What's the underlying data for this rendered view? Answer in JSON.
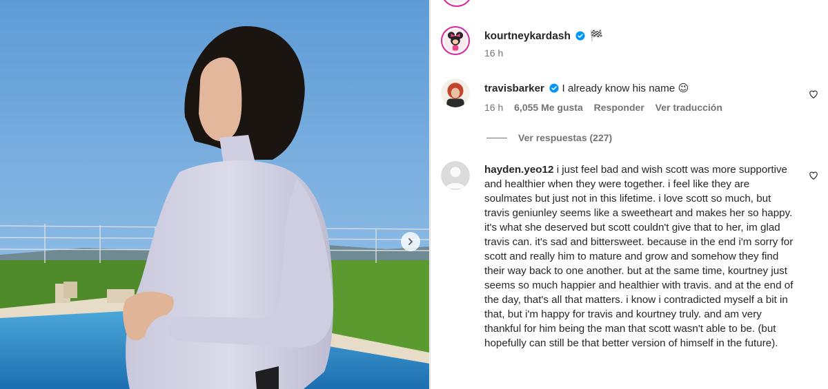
{
  "post": {
    "author": "kourtneykardash",
    "author_time": "16 h",
    "flag_emoji": "🏁"
  },
  "comments": [
    {
      "user": "travisbarker",
      "verified": true,
      "text": "I already know his name 😉",
      "time": "16 h",
      "likes": "6,055 Me gusta",
      "reply": "Responder",
      "translate": "Ver traducción"
    },
    {
      "user": "hayden.yeo12",
      "verified": false,
      "text": "i just feel bad and wish scott was more supportive and healthier when they were together. i feel like they are soulmates but just not in this lifetime. i love scott so much, but travis geniunley seems like a sweetheart and makes her so happy. it's what she deserved but scott couldn't give that to her, im glad travis can. it's sad and bittersweet. because in the end i'm sorry for scott and really him to mature and grow and somehow they find their way back to one another. but at the same time, kourtney just seems so much happier and healthier with travis. and at the end of the day, that's all that matters. i know i contradicted myself a bit in that, but i'm happy for travis and kourtney truly. and am very thankful for him being the man that scott wasn't able to be. (but hopefully can still be that better version of himself in the future)."
    }
  ],
  "view_replies": "Ver respuestas (227)",
  "colors": {
    "text": "#262626",
    "muted": "#737373",
    "verified": "#0095f6",
    "story_ring": "#d6249f"
  },
  "icons": [
    "chevron-right-icon",
    "verified-icon",
    "heart-icon"
  ]
}
